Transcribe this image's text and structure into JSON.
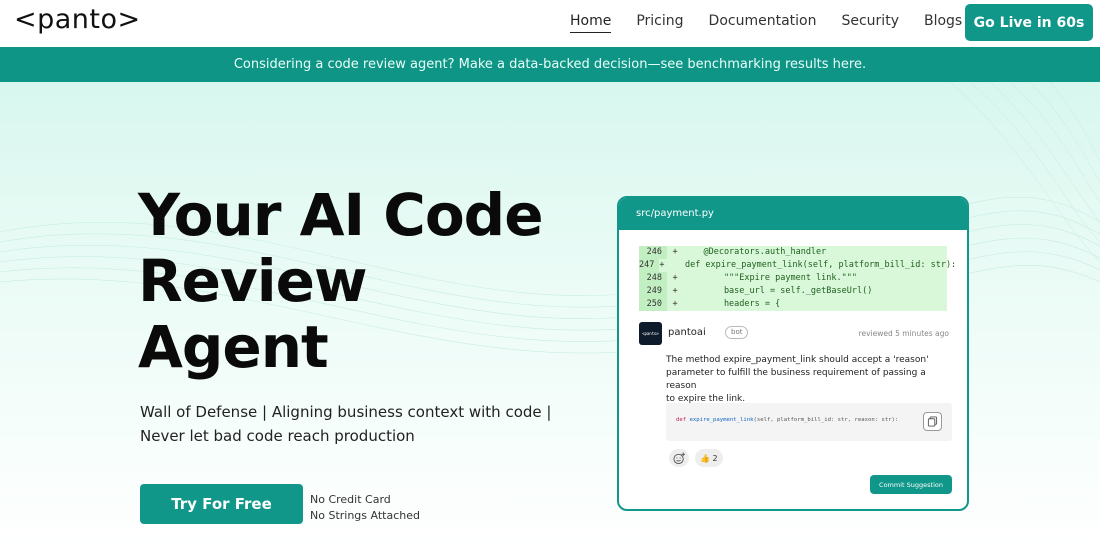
{
  "nav": {
    "logo": "<panto>",
    "links": [
      {
        "label": "Home",
        "active": true
      },
      {
        "label": "Pricing"
      },
      {
        "label": "Documentation"
      },
      {
        "label": "Security"
      },
      {
        "label": "Blogs"
      }
    ],
    "cta": "Go Live in 60s"
  },
  "banner": {
    "text": "Considering a code review agent? Make a data-backed decision—see benchmarking results here."
  },
  "hero": {
    "title_line1": "Your AI Code",
    "title_line2": "Review",
    "title_line3": "Agent",
    "subtitle_line1": "Wall of Defense | Aligning business context with code |",
    "subtitle_line2": "Never let bad code reach production",
    "cta": "Try For Free",
    "note_line1": "No Credit Card",
    "note_line2": "No Strings Attached"
  },
  "card": {
    "file": "src/payment.py",
    "diff": [
      {
        "line": "246",
        "sign": "+",
        "code": "    @Decorators.auth_handler"
      },
      {
        "line": "247",
        "sign": "+",
        "code": "    def expire_payment_link(self, platform_bill_id: str):"
      },
      {
        "line": "248",
        "sign": "+",
        "code": "        \"\"\"Expire payment link.\"\"\""
      },
      {
        "line": "249",
        "sign": "+",
        "code": "        base_url = self._getBaseUrl()"
      },
      {
        "line": "250",
        "sign": "+",
        "code": "        headers = {"
      }
    ],
    "reviewer": {
      "avatar_text": "<panto>",
      "name": "pantoai",
      "badge": "bot",
      "time": "reviewed 5 minutes ago"
    },
    "comment_line1": "The method expire_payment_link should accept a 'reason'",
    "comment_line2": "parameter to fulfill the business requirement of passing a reason",
    "comment_line3": "to expire the link.",
    "suggestion": {
      "kw": "def",
      "fn": "expire_payment_link",
      "rest": "(self, platform_bill_id: str, reason: str):"
    },
    "reactions": {
      "thumbs": "👍 2"
    },
    "commit_label": "Commit Suggestion"
  },
  "colors": {
    "brand": "#10978a",
    "banner": "#0f9585",
    "diff_bg": "#d9f8d9"
  }
}
